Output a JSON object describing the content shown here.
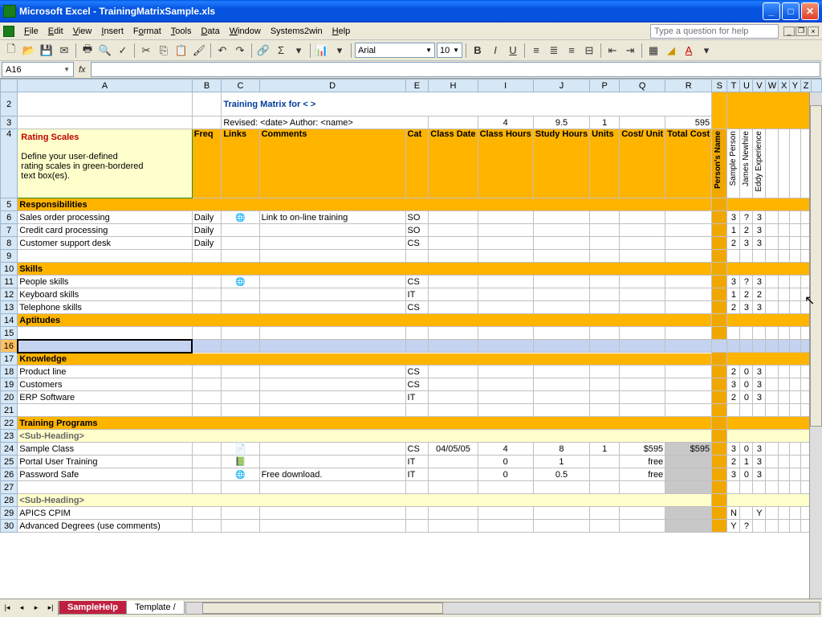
{
  "window": {
    "title": "Microsoft Excel - TrainingMatrixSample.xls"
  },
  "menus": [
    "File",
    "Edit",
    "View",
    "Insert",
    "Format",
    "Tools",
    "Data",
    "Window",
    "Systems2win",
    "Help"
  ],
  "help_placeholder": "Type a question for help",
  "namebox": "A16",
  "font": "Arial",
  "fontsize": "10",
  "colhdrs": [
    "A",
    "B",
    "C",
    "D",
    "E",
    "H",
    "I",
    "J",
    "P",
    "Q",
    "R",
    "S",
    "T",
    "U",
    "V",
    "W",
    "X",
    "Y",
    "Z"
  ],
  "title_text": "Training Matrix for < >",
  "revised_text": "Revised:  <date>  Author:  <name>",
  "totals": {
    "i": "4",
    "j": "9.5",
    "p": "1",
    "r": "595"
  },
  "rating": {
    "title": "Rating Scales",
    "body1": "Define your user-defined",
    "body2": "rating scales in green-bordered",
    "body3": "text box(es)."
  },
  "hdrs": {
    "freq": "Freq",
    "links": "Links",
    "comments": "Comments",
    "cat": "Cat",
    "classdate": "Class Date",
    "classhrs": "Class Hours",
    "studyhrs": "Study Hours",
    "units": "Units",
    "costunit": "Cost/ Unit",
    "totalcost": "Total Cost",
    "pname": "Person's Name"
  },
  "people": [
    "Sample Person",
    "James Newhire",
    "Eddy Experience"
  ],
  "sections": {
    "resp": "Responsibilities",
    "skills": "Skills",
    "apt": "Aptitudes",
    "know": "Knowledge",
    "train": "Training Programs",
    "sub": "<Sub-Heading>"
  },
  "rows": {
    "r6": {
      "a": "Sales order processing",
      "b": "Daily",
      "d": "Link to on-line training",
      "e": "SO",
      "t": "3",
      "u": "?",
      "v": "3"
    },
    "r7": {
      "a": "Credit card processing",
      "b": "Daily",
      "e": "SO",
      "t": "1",
      "u": "2",
      "v": "3"
    },
    "r8": {
      "a": "Customer support desk",
      "b": "Daily",
      "e": "CS",
      "t": "2",
      "u": "3",
      "v": "3"
    },
    "r11": {
      "a": "People skills",
      "e": "CS",
      "t": "3",
      "u": "?",
      "v": "3"
    },
    "r12": {
      "a": "Keyboard skills",
      "e": "IT",
      "t": "1",
      "u": "2",
      "v": "2"
    },
    "r13": {
      "a": "Telephone skills",
      "e": "CS",
      "t": "2",
      "u": "3",
      "v": "3"
    },
    "r18": {
      "a": "Product line",
      "e": "CS",
      "t": "2",
      "u": "0",
      "v": "3"
    },
    "r19": {
      "a": "Customers",
      "e": "CS",
      "t": "3",
      "u": "0",
      "v": "3"
    },
    "r20": {
      "a": "ERP Software",
      "e": "IT",
      "t": "2",
      "u": "0",
      "v": "3"
    },
    "r24": {
      "a": "Sample Class",
      "e": "CS",
      "h": "04/05/05",
      "i": "4",
      "j": "8",
      "p": "1",
      "q": "$595",
      "r": "$595",
      "t": "3",
      "u": "0",
      "v": "3"
    },
    "r25": {
      "a": "Portal User Training",
      "e": "IT",
      "i": "0",
      "j": "1",
      "q": "free",
      "t": "2",
      "u": "1",
      "v": "3"
    },
    "r26": {
      "a": "Password Safe",
      "d": "Free download.",
      "e": "IT",
      "i": "0",
      "j": "0.5",
      "q": "free",
      "t": "3",
      "u": "0",
      "v": "3"
    },
    "r29": {
      "a": "APICS CPIM",
      "t": "N",
      "v": "Y"
    },
    "r30": {
      "a": "Advanced Degrees (use comments)",
      "t": "Y",
      "u": "?"
    }
  },
  "tabs": {
    "active": "SampleHelp",
    "other": "Template"
  }
}
